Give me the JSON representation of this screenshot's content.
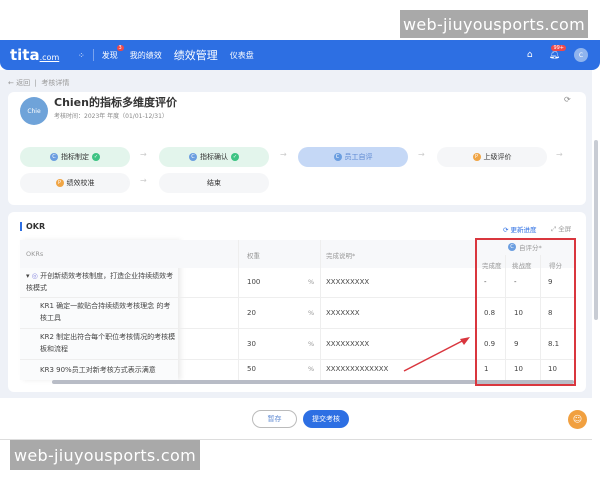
{
  "watermark": "web-jiuyousports.com",
  "nav": {
    "logo": "tita",
    "logo_suffix": ".com",
    "items": [
      {
        "label": "发现",
        "badge": "3"
      },
      {
        "label": "我的绩效"
      },
      {
        "label": "绩效管理"
      },
      {
        "label": "仪表盘"
      }
    ],
    "notif_badge": "99+",
    "user_initial": "C",
    "brand_color": "#2d6fe3"
  },
  "breadcrumb": {
    "back": "返回",
    "current": "考核详情"
  },
  "review": {
    "avatar": "Chie",
    "title": "Chien的指标多维度评价",
    "period": "考核时间：2023年 年度（01/01-12/31）",
    "steps": [
      {
        "label": "指标制定",
        "state": "done"
      },
      {
        "label": "指标确认",
        "state": "done"
      },
      {
        "label": "员工自评",
        "state": "active"
      },
      {
        "label": "上级评价",
        "state": "pending"
      },
      {
        "label": "绩效校准",
        "state": "pending"
      },
      {
        "label": "结束",
        "state": "pending"
      }
    ]
  },
  "okr": {
    "title": "OKR",
    "refresh": "更新进度",
    "fullscreen": "全屏",
    "headers": {
      "okrs": "OKRs",
      "weight": "权重",
      "desc": "完成说明*",
      "self": "自评分*",
      "completion": "完成度",
      "challenge": "挑战度",
      "score": "得分"
    },
    "rows": [
      {
        "name": "开创新绩效考核制度，打造企业持续绩效考核模式",
        "weight": "100",
        "unit": "%",
        "desc": "XXXXXXXXX",
        "completion": "-",
        "challenge": "-",
        "score": "9"
      },
      {
        "name": "KR1 确定一款贴合持续绩效考核理念 的考核工具",
        "weight": "20",
        "unit": "%",
        "desc": "XXXXXXX",
        "completion": "0.8",
        "challenge": "10",
        "score": "8"
      },
      {
        "name": "KR2 制定出符合每个职位考核情况的考核模板和流程",
        "weight": "30",
        "unit": "%",
        "desc": "XXXXXXXXX",
        "completion": "0.9",
        "challenge": "9",
        "score": "8.1"
      },
      {
        "name": "KR3 90%员工对新考核方式表示满意",
        "weight": "50",
        "unit": "%",
        "desc": "XXXXXXXXXXXXX",
        "completion": "1",
        "challenge": "10",
        "score": "10"
      }
    ]
  },
  "footer": {
    "save": "暂存",
    "submit": "提交考核"
  }
}
